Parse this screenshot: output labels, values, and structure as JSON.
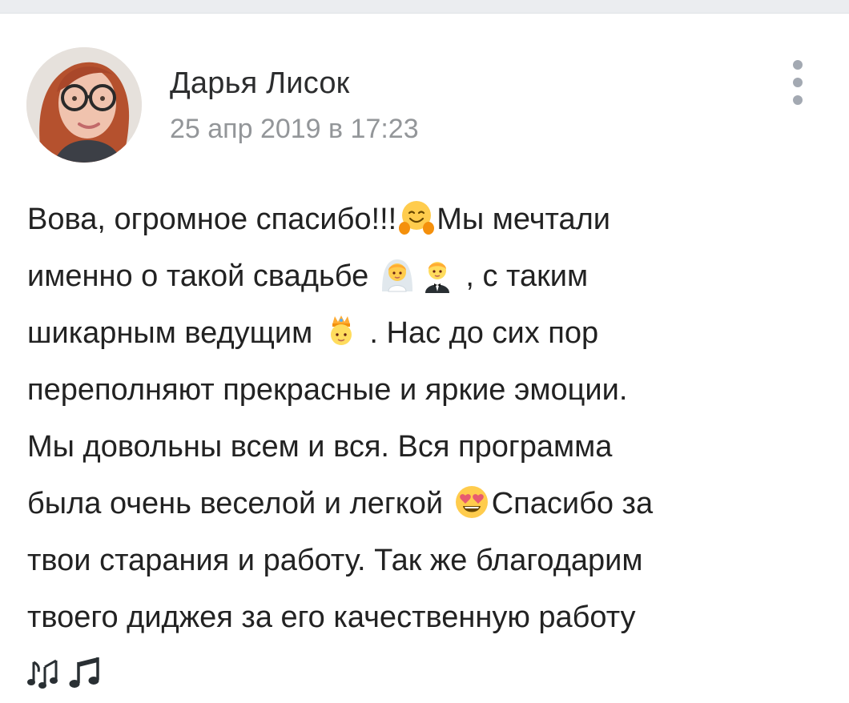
{
  "post": {
    "author": "Дарья Лисок",
    "date": "25 апр 2019 в 17:23",
    "text_lines": [
      [
        "Вова, огромное спасибо!!!",
        "Мы мечтали"
      ],
      [
        "именно о такой свадьбе ",
        " , с таким"
      ],
      [
        "шикарным ведущим ",
        " . Нас до сих пор"
      ],
      [
        "переполняют прекрасные и яркие эмоции."
      ],
      [
        "Мы довольны всем и вся. Вся программа"
      ],
      [
        "была очень веселой и легкой ",
        "Спасибо за"
      ],
      [
        "твои старания и работу. Так же благодарим"
      ],
      [
        "твоего диджея за его качественную работу"
      ]
    ],
    "emojis": [
      "hugging-face",
      "bride-with-veil",
      "man-in-tuxedo",
      "prince",
      "heart-eyes-face",
      "musical-notes",
      "musical-note"
    ]
  },
  "colors": {
    "name": "#2c2d2e",
    "date": "#939699",
    "text": "#222222",
    "menu_dots": "#a3a9b2",
    "top_strip": "#ebedf0"
  }
}
